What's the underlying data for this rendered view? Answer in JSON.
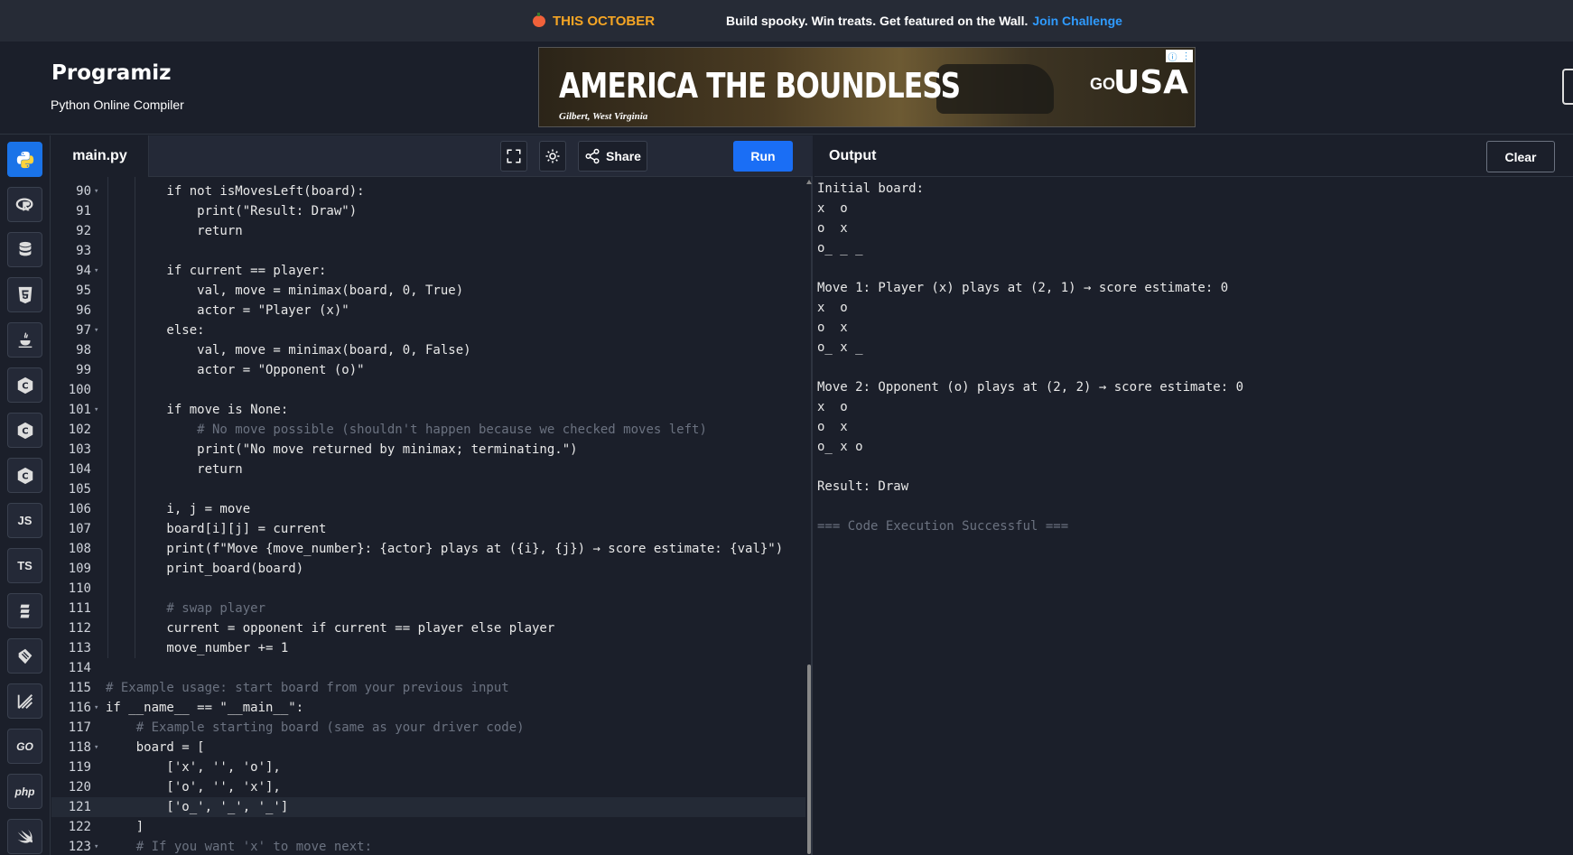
{
  "promo": {
    "left": "THIS OCTOBER",
    "text": "Build spooky. Win treats. Get featured on the Wall.",
    "link": "Join Challenge"
  },
  "header": {
    "logo": "Programiz",
    "subtitle": "Python Online Compiler"
  },
  "ad": {
    "title": "AMERICA THE BOUNDLESS",
    "caption": "Gilbert, West Virginia",
    "brand_go": "GO",
    "brand_usa": "USA"
  },
  "rail": {
    "items": [
      "python",
      "r",
      "sql",
      "html",
      "java",
      "c",
      "cpp",
      "csharp",
      "JS",
      "TS",
      "swift-stack",
      "rust",
      "kotlin",
      "GO",
      "php",
      "swift"
    ]
  },
  "editor": {
    "file_tab": "main.py",
    "share_label": "Share",
    "run_label": "Run",
    "current_line": 121
  },
  "output": {
    "title": "Output",
    "clear_label": "Clear",
    "lines": [
      "Initial board:",
      "x  o",
      "o  x",
      "o_ _ _",
      "",
      "Move 1: Player (x) plays at (2, 1) → score estimate: 0",
      "x  o",
      "o  x",
      "o_ x _",
      "",
      "Move 2: Opponent (o) plays at (2, 2) → score estimate: 0",
      "x  o",
      "o  x",
      "o_ x o",
      "",
      "Result: Draw",
      "",
      "=== Code Execution Successful ==="
    ]
  },
  "code": [
    {
      "n": "90",
      "fold": true,
      "text": "        if not isMovesLeft(board):"
    },
    {
      "n": "91",
      "fold": false,
      "text": "            print(\"Result: Draw\")"
    },
    {
      "n": "92",
      "fold": false,
      "text": "            return"
    },
    {
      "n": "93",
      "fold": false,
      "text": ""
    },
    {
      "n": "94",
      "fold": true,
      "text": "        if current == player:"
    },
    {
      "n": "95",
      "fold": false,
      "text": "            val, move = minimax(board, 0, True)"
    },
    {
      "n": "96",
      "fold": false,
      "text": "            actor = \"Player (x)\""
    },
    {
      "n": "97",
      "fold": true,
      "text": "        else:"
    },
    {
      "n": "98",
      "fold": false,
      "text": "            val, move = minimax(board, 0, False)"
    },
    {
      "n": "99",
      "fold": false,
      "text": "            actor = \"Opponent (o)\""
    },
    {
      "n": "100",
      "fold": false,
      "text": ""
    },
    {
      "n": "101",
      "fold": true,
      "text": "        if move is None:"
    },
    {
      "n": "102",
      "fold": false,
      "text": "            # No move possible (shouldn't happen because we checked moves left)"
    },
    {
      "n": "103",
      "fold": false,
      "text": "            print(\"No move returned by minimax; terminating.\")"
    },
    {
      "n": "104",
      "fold": false,
      "text": "            return"
    },
    {
      "n": "105",
      "fold": false,
      "text": ""
    },
    {
      "n": "106",
      "fold": false,
      "text": "        i, j = move"
    },
    {
      "n": "107",
      "fold": false,
      "text": "        board[i][j] = current"
    },
    {
      "n": "108",
      "fold": false,
      "text": "        print(f\"Move {move_number}: {actor} plays at ({i}, {j}) → score estimate: {val}\")"
    },
    {
      "n": "109",
      "fold": false,
      "text": "        print_board(board)"
    },
    {
      "n": "110",
      "fold": false,
      "text": ""
    },
    {
      "n": "111",
      "fold": false,
      "text": "        # swap player"
    },
    {
      "n": "112",
      "fold": false,
      "text": "        current = opponent if current == player else player"
    },
    {
      "n": "113",
      "fold": false,
      "text": "        move_number += 1"
    },
    {
      "n": "114",
      "fold": false,
      "text": ""
    },
    {
      "n": "115",
      "fold": false,
      "text": "# Example usage: start board from your previous input"
    },
    {
      "n": "116",
      "fold": true,
      "text": "if __name__ == \"__main__\":"
    },
    {
      "n": "117",
      "fold": false,
      "text": "    # Example starting board (same as your driver code)"
    },
    {
      "n": "118",
      "fold": true,
      "text": "    board = ["
    },
    {
      "n": "119",
      "fold": false,
      "text": "        ['x', '', 'o'],"
    },
    {
      "n": "120",
      "fold": false,
      "text": "        ['o', '', 'x'],"
    },
    {
      "n": "121",
      "fold": false,
      "text": "        ['o_', '_', '_']"
    },
    {
      "n": "122",
      "fold": false,
      "text": "    ]"
    },
    {
      "n": "123",
      "fold": true,
      "text": "    # If you want 'x' to move next:"
    }
  ]
}
